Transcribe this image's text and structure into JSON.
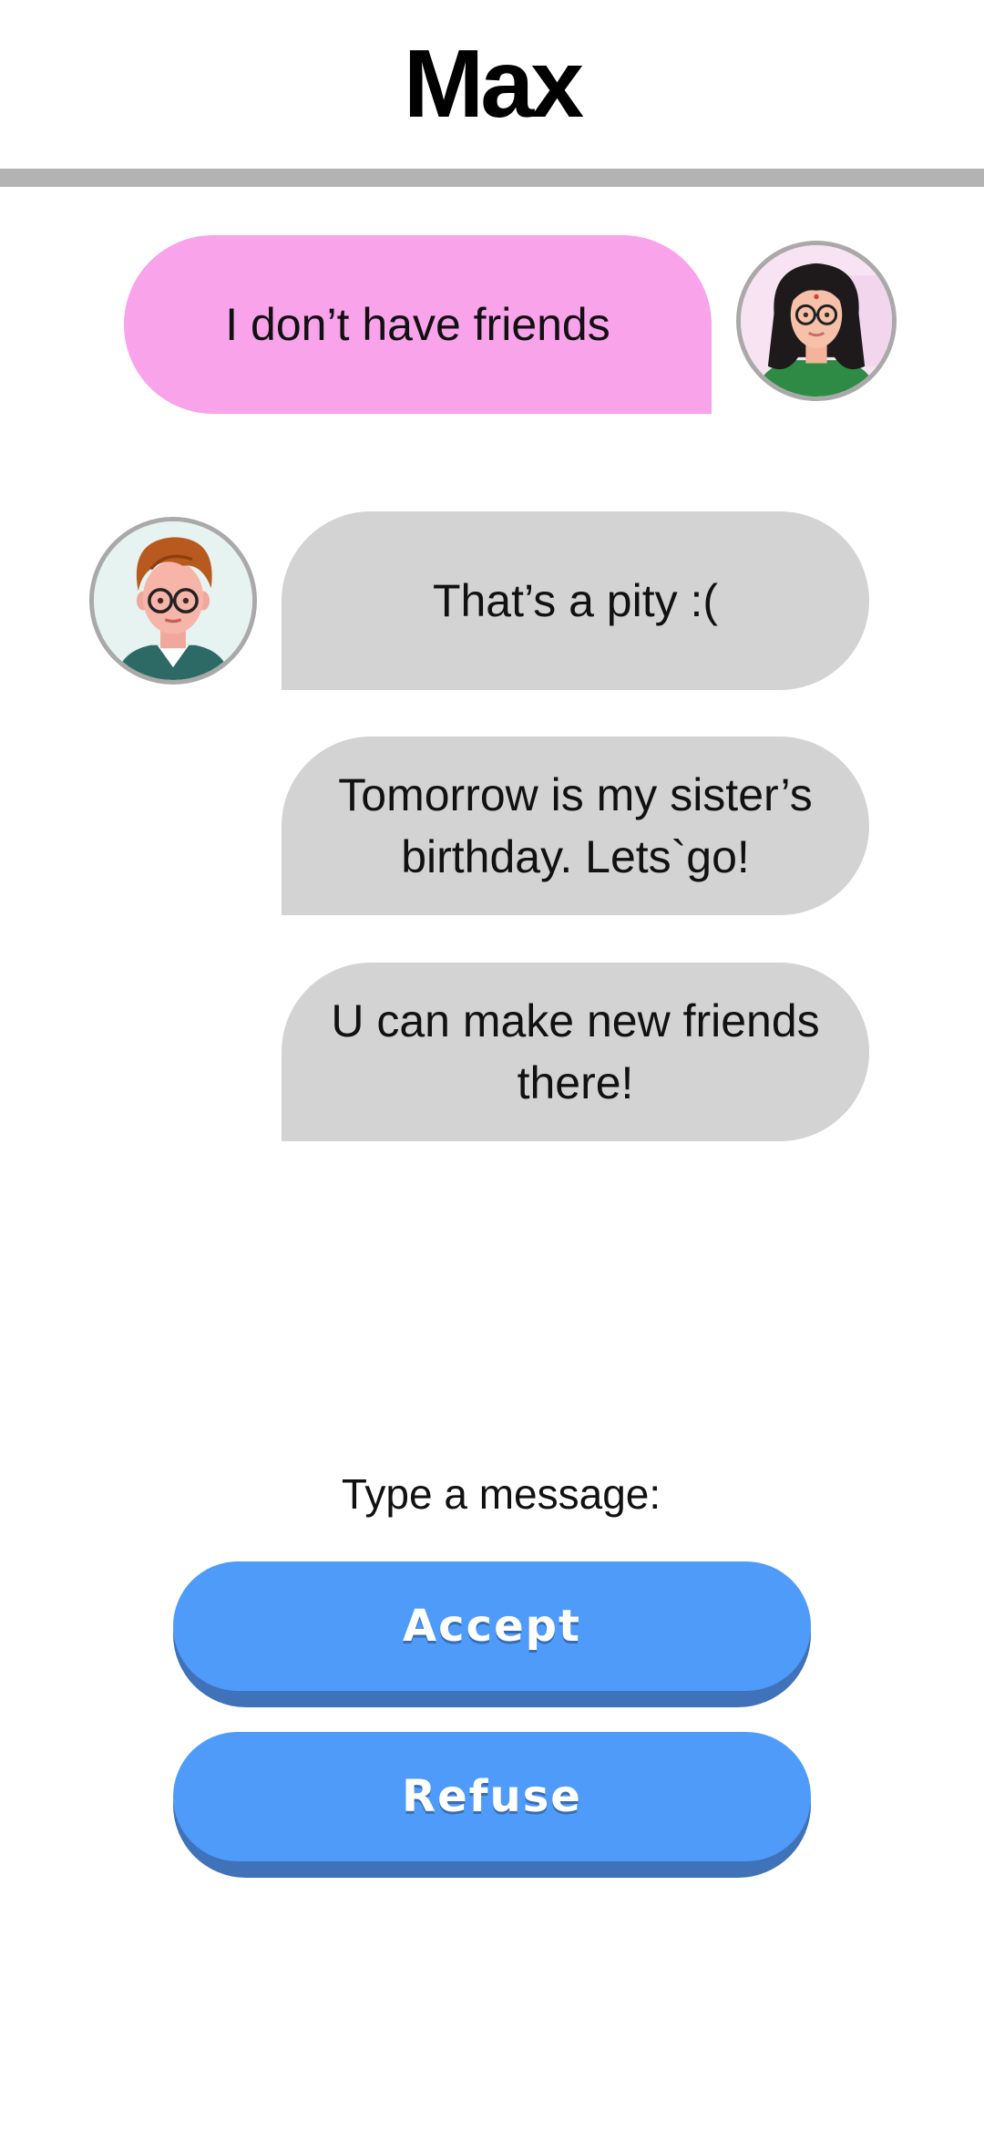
{
  "header": {
    "title": "Max"
  },
  "messages": [
    {
      "from": "me",
      "text": "I don’t have friends"
    },
    {
      "from": "max",
      "text": "That’s a pity :("
    },
    {
      "from": "max",
      "text": "Tomorrow is my sister’s birthday. Lets`go!"
    },
    {
      "from": "max",
      "text": "U can make new friends there!"
    }
  ],
  "composer": {
    "prompt": "Type a message:",
    "options": [
      {
        "label": "Accept"
      },
      {
        "label": "Refuse"
      }
    ]
  },
  "colors": {
    "sent_bubble": "#f8a3ea",
    "received_bubble": "#d3d3d3",
    "button": "#4f9bfa",
    "button_shadow": "#3f72b9",
    "divider": "#b3b3b3"
  },
  "icons": {
    "my_avatar": "girl-with-glasses-avatar",
    "contact_avatar": "redhead-boy-with-glasses-avatar"
  }
}
